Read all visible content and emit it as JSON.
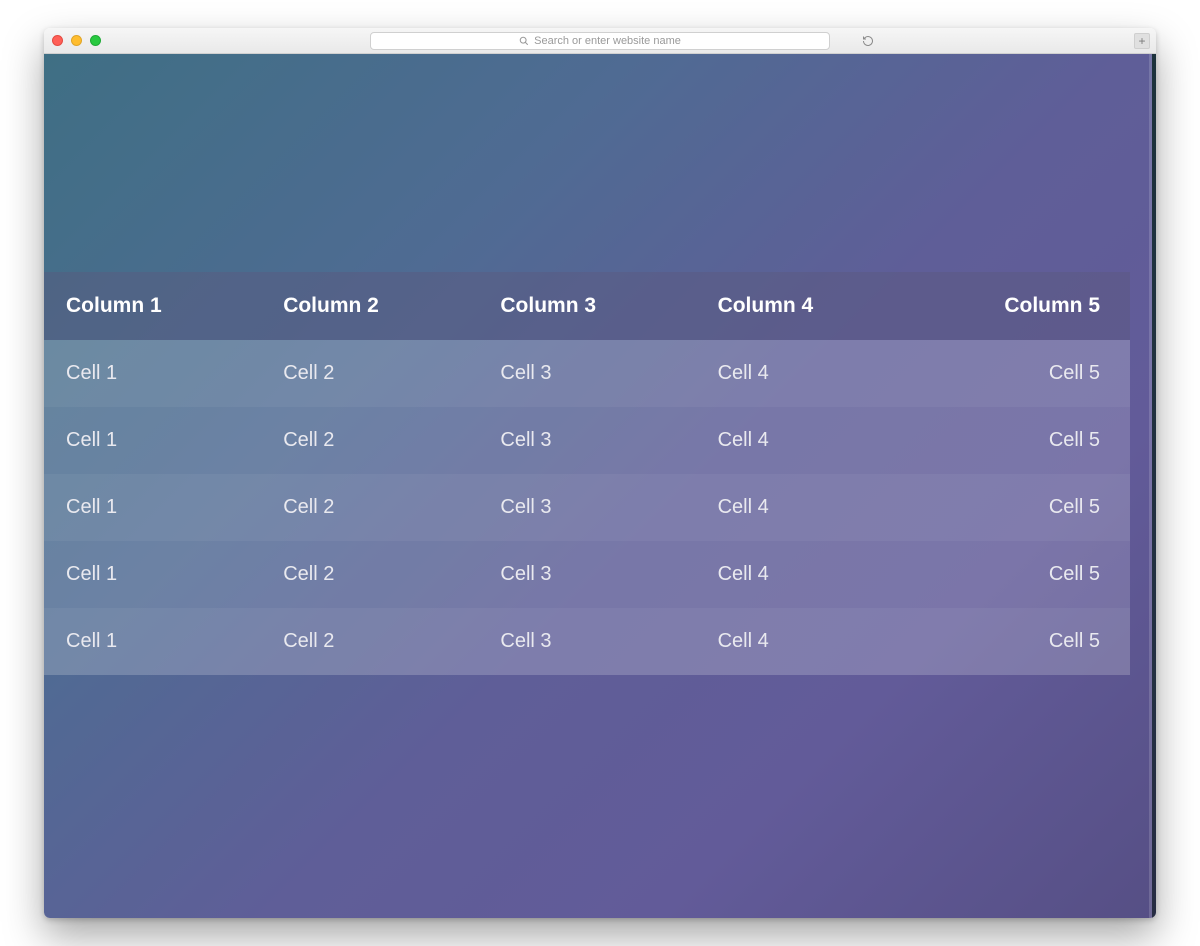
{
  "browser": {
    "address_placeholder": "Search or enter website name"
  },
  "table": {
    "headers": [
      "Column 1",
      "Column 2",
      "Column 3",
      "Column 4",
      "Column 5"
    ],
    "rows": [
      [
        "Cell 1",
        "Cell 2",
        "Cell 3",
        "Cell 4",
        "Cell 5"
      ],
      [
        "Cell 1",
        "Cell 2",
        "Cell 3",
        "Cell 4",
        "Cell 5"
      ],
      [
        "Cell 1",
        "Cell 2",
        "Cell 3",
        "Cell 4",
        "Cell 5"
      ],
      [
        "Cell 1",
        "Cell 2",
        "Cell 3",
        "Cell 4",
        "Cell 5"
      ],
      [
        "Cell 1",
        "Cell 2",
        "Cell 3",
        "Cell 4",
        "Cell 5"
      ]
    ]
  }
}
